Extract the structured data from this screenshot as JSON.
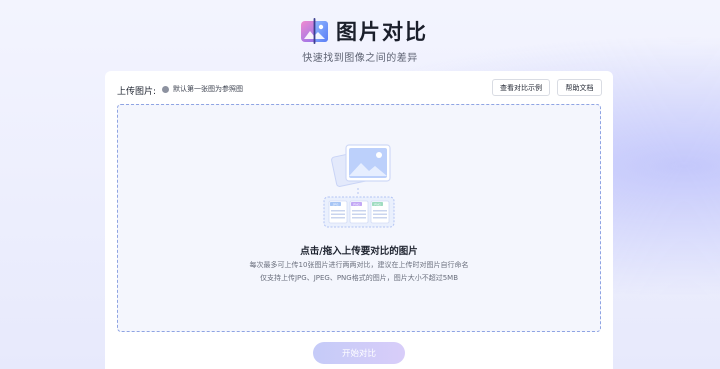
{
  "header": {
    "title": "图片对比",
    "subtitle": "快速找到图像之间的差异",
    "logo_icon": "image-compare-logo-icon"
  },
  "toolbar": {
    "upload_label": "上传图片:",
    "info_icon": "info-circle-icon",
    "default_hint": "默认第一张图为参照图",
    "example_button": "查看对比示例",
    "help_button": "帮助文档"
  },
  "dropzone": {
    "illustration_icon": "image-upload-illustration-icon",
    "file_types": [
      "JPG",
      "PNG",
      "PNG"
    ],
    "title": "点击/拖入上传要对比的图片",
    "line1": "每次最多可上传10张图片进行两两对比，建议在上传时对图片自行命名",
    "line2": "仅支持上传JPG、JPEG、PNG格式的图片，图片大小不超过5MB"
  },
  "actions": {
    "start_button": "开始对比"
  },
  "colors": {
    "accent": "#7b8ff0",
    "dashed_border": "#8fa4e3",
    "start_gradient_from": "#c5cbf8",
    "start_gradient_to": "#d8cdf9"
  }
}
